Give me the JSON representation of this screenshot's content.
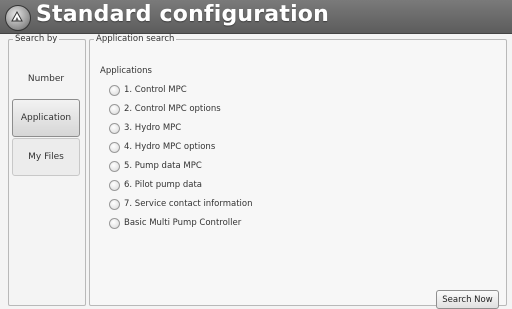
{
  "header": {
    "title": "Standard configuration"
  },
  "search_by": {
    "legend": "Search by",
    "buttons": [
      {
        "label": "Number",
        "active": false
      },
      {
        "label": "Application",
        "active": true
      },
      {
        "label": "My Files",
        "active": false
      }
    ]
  },
  "application_search": {
    "legend": "Application search",
    "section_label": "Applications",
    "options": [
      "1. Control MPC",
      "2. Control MPC options",
      "3. Hydro MPC",
      "4. Hydro MPC options",
      "5. Pump data MPC",
      "6. Pilot pump data",
      "7. Service contact information",
      "Basic Multi Pump Controller"
    ],
    "search_button": "Search Now"
  }
}
